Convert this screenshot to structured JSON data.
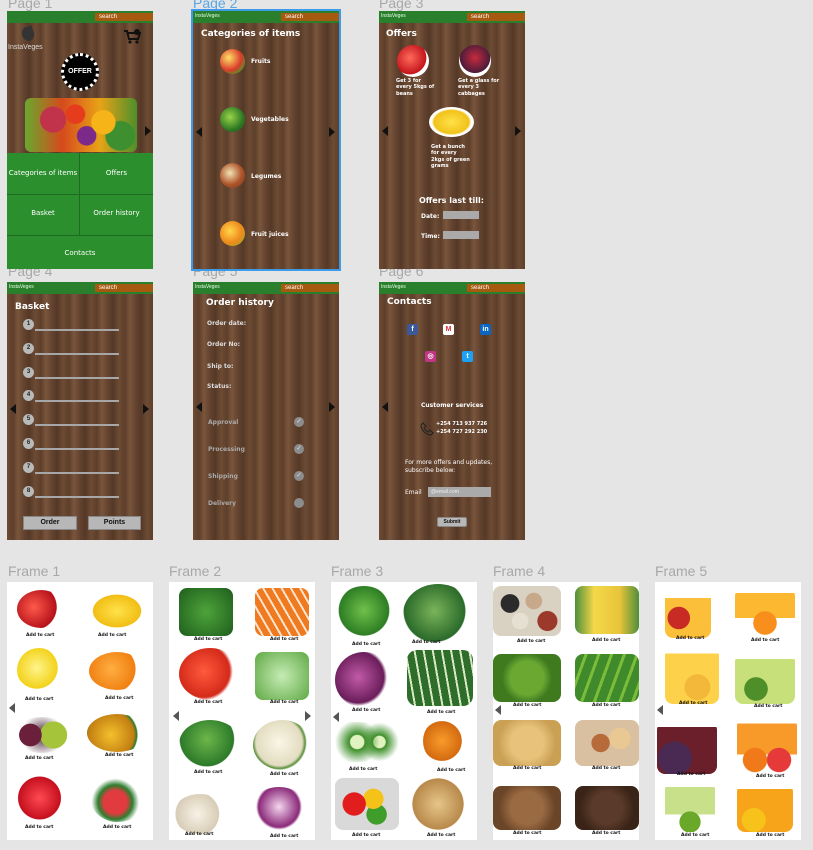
{
  "labels": {
    "page1": "Page 1",
    "page2": "Page 2",
    "page3": "Page 3",
    "page4": "Page 4",
    "page5": "Page 5",
    "page6": "Page 6",
    "frame1": "Frame 1",
    "frame2": "Frame 2",
    "frame3": "Frame 3",
    "frame4": "Frame 4",
    "frame5": "Frame 5"
  },
  "common": {
    "search": "search",
    "logo": "InstaVeges",
    "add_to_cart": "Add to cart"
  },
  "page1": {
    "logo": "InstaVeges",
    "offer_badge": "OFFER",
    "menu": [
      "Categories of items",
      "Offers",
      "Basket",
      "Order history",
      "Contacts"
    ]
  },
  "page2": {
    "title": "Categories of items",
    "categories": [
      "Fruits",
      "Vegetables",
      "Legumes",
      "Fruit juices"
    ]
  },
  "page3": {
    "title": "Offers",
    "offer1": "Get 3 for every 5kgs of beans",
    "offer2": "Get a glass for every 3 cabbages",
    "offer3": "Get a bunch for every 2kgs of green grams",
    "offers_last": "Offers last till:",
    "date_label": "Date:",
    "time_label": "Time:"
  },
  "page4": {
    "title": "Basket",
    "numbers": [
      "1",
      "2",
      "3",
      "4",
      "5",
      "6",
      "7",
      "8"
    ],
    "order_btn": "Order",
    "points_btn": "Points"
  },
  "page5": {
    "title": "Order history",
    "fields": [
      "Order date:",
      "Order No:",
      "Ship to:",
      "Status:"
    ],
    "steps": [
      "Approval",
      "Processing",
      "Shipping",
      "Delivery"
    ]
  },
  "page6": {
    "title": "Contacts",
    "customer_services": "Customer services",
    "phone1": "+254 713 937 726",
    "phone2": "+254 727 292 230",
    "subscribe_text": "For more offers and updates, subscribe below:",
    "email_label": "Email",
    "email_placeholder": "@email.com",
    "submit": "Submit"
  },
  "colors": {
    "green": "#2a7f2c",
    "orange_search": "#a65a10",
    "selection": "#3d9be9"
  }
}
